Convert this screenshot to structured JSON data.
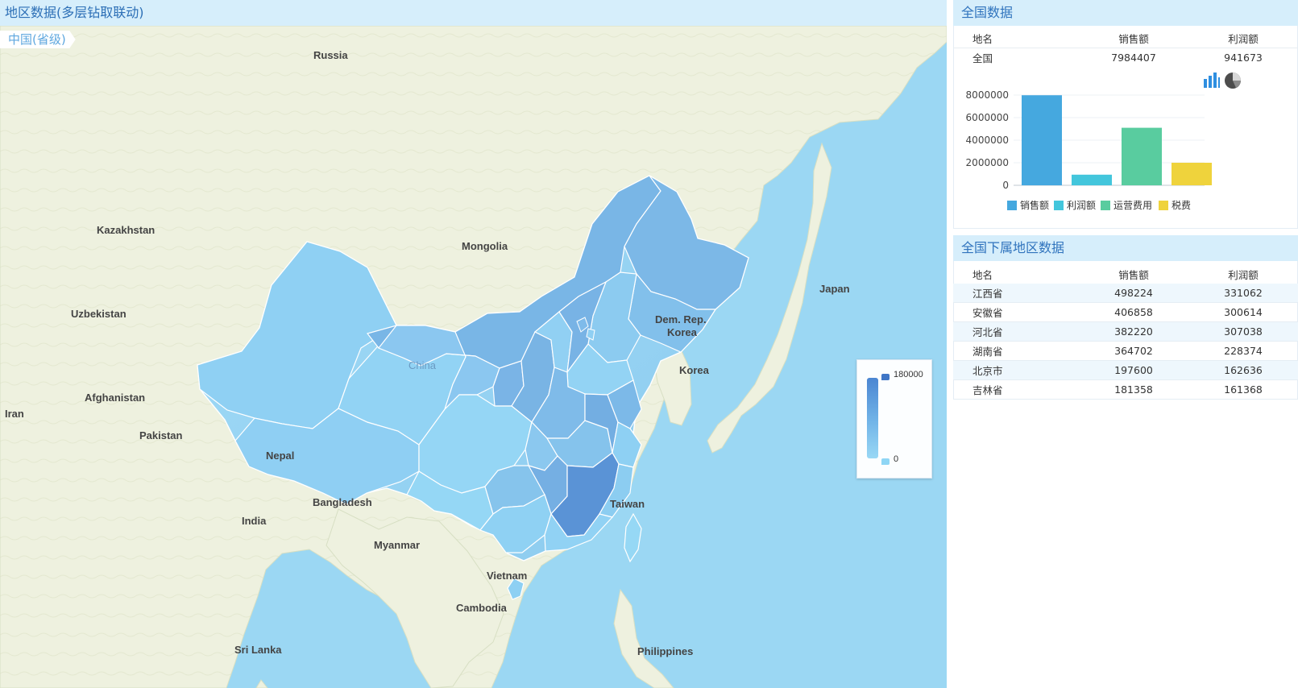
{
  "left": {
    "header_title": "地区数据(多层钻取联动)",
    "breadcrumb": "中国(省级)",
    "map_labels": {
      "russia": "Russia",
      "kazakhstan": "Kazakhstan",
      "mongolia": "Mongolia",
      "uzbekistan": "Uzbekistan",
      "china": "China",
      "afghanistan": "Afghanistan",
      "iran": "Iran",
      "pakistan": "Pakistan",
      "nepal": "Nepal",
      "india": "India",
      "bangladesh": "Bangladesh",
      "myanmar": "Myanmar",
      "vietnam": "Vietnam",
      "cambodia": "Cambodia",
      "sri_lanka": "Sri Lanka",
      "philippines": "Philippines",
      "taiwan": "Taiwan",
      "dem_rep": "Dem. Rep.",
      "korea": "Korea",
      "korea_south": "Korea",
      "japan": "Japan"
    },
    "legend": {
      "max": "180000",
      "min": "0"
    },
    "colors": {
      "ocean": "#9bd7f3",
      "land": "#eef1df",
      "china_light": "#9bd8f5",
      "china_mid": "#84c1ec",
      "china_dark": "#6ba5df",
      "china_darkest": "#5c95d7"
    }
  },
  "right": {
    "national": {
      "title": "全国数据",
      "columns": [
        "地名",
        "销售额",
        "利润额"
      ],
      "row": [
        "全国",
        "7984407",
        "941673"
      ],
      "icons": {
        "bar": "bar-chart-icon",
        "pie": "pie-chart-icon"
      }
    },
    "subregions": {
      "title": "全国下属地区数据",
      "columns": [
        "地名",
        "销售额",
        "利润额"
      ],
      "rows": [
        [
          "江西省",
          "498224",
          "331062"
        ],
        [
          "安徽省",
          "406858",
          "300614"
        ],
        [
          "河北省",
          "382220",
          "307038"
        ],
        [
          "湖南省",
          "364702",
          "228374"
        ],
        [
          "北京市",
          "197600",
          "162636"
        ],
        [
          "吉林省",
          "181358",
          "161368"
        ]
      ]
    },
    "chart_data": {
      "type": "bar",
      "categories": [
        "销售额",
        "利润额",
        "运营费用",
        "税费"
      ],
      "values": [
        7984407,
        941673,
        5100000,
        2000000
      ],
      "colors": [
        "#45a8df",
        "#43c6dc",
        "#59cc9f",
        "#efd33c"
      ],
      "ylim": [
        0,
        8000000
      ],
      "yticks": [
        "8000000",
        "6000000",
        "4000000",
        "2000000",
        "0"
      ],
      "legend": [
        "销售额",
        "利润额",
        "运营费用",
        "税费"
      ],
      "legend_position": "bottom",
      "grid": true
    }
  }
}
